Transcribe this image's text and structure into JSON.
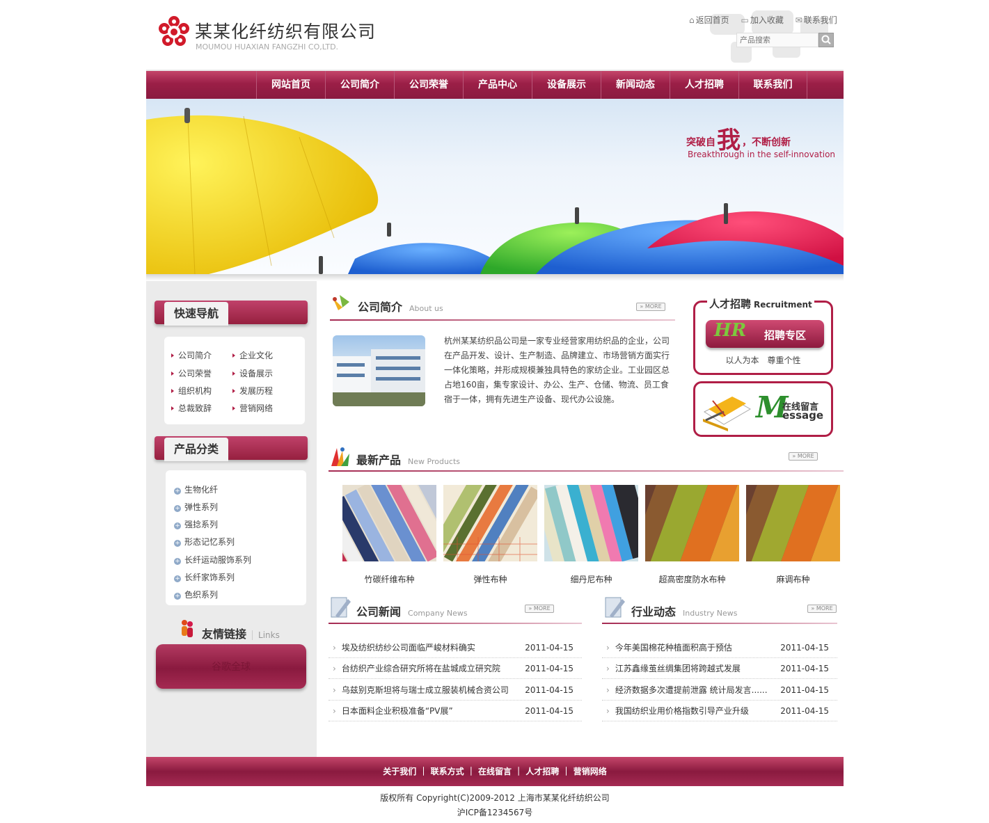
{
  "header": {
    "company_cn": "某某化纤纺织有限公司",
    "company_en": "MOUMOU HUAXIAN FANGZHI CO,LTD.",
    "top_links": [
      "返回首页",
      "加入收藏",
      "联系我们"
    ],
    "search_placeholder": "产品搜索"
  },
  "nav": [
    "网站首页",
    "公司简介",
    "公司荣誉",
    "产品中心",
    "设备展示",
    "新闻动态",
    "人才招聘",
    "联系我们"
  ],
  "banner": {
    "slogan_a": "突破自",
    "slogan_big": "我",
    "slogan_b": "，不断创新",
    "slogan_en": "Breakthrough in the self-innovation"
  },
  "quick_nav": {
    "title": "快速导航",
    "items": [
      "公司简介",
      "企业文化",
      "公司荣誉",
      "设备展示",
      "组织机构",
      "发展历程",
      "总裁致辞",
      "营销网络"
    ]
  },
  "categories": {
    "title": "产品分类",
    "items": [
      "生物化纤",
      "弹性系列",
      "强捻系列",
      "形态记忆系列",
      "长纤运动服饰系列",
      "长纤家饰系列",
      "色织系列"
    ]
  },
  "links": {
    "title": "友情链接",
    "title_en": "Links",
    "items": [
      "谷歌全球"
    ]
  },
  "about": {
    "title": "公司简介",
    "title_en": "About us",
    "more": "MORE",
    "text": "杭州某某纺织品公司是一家专业经营家用纺织品的企业，公司在产品开发、设计、生产制造、品牌建立、市场营销方面实行一体化策略，并形成规模兼独具特色的家纺企业。工业园区总占地160亩，集专家设计、办公、生产、仓储、物流、员工食宿于一体，拥有先进生产设备、现代办公设施。"
  },
  "products": {
    "title": "最新产品",
    "title_en": "New Products",
    "more": "MORE",
    "items": [
      "竹碳纤维布种",
      "弹性布种",
      "细丹尼布种",
      "超高密度防水布种",
      "麻调布种"
    ]
  },
  "company_news": {
    "title": "公司新闻",
    "title_en": "Company News",
    "more": "MORE",
    "items": [
      {
        "title": "埃及纺织纺纱公司面临严峻材料确实",
        "date": "2011-04-15"
      },
      {
        "title": "台纺织产业综合研究所将在盐城成立研究院",
        "date": "2011-04-15"
      },
      {
        "title": "乌兹别克斯坦将与瑞士成立服装机械合资公司",
        "date": "2011-04-15"
      },
      {
        "title": "日本面料企业积极准备“PV展”",
        "date": "2011-04-15"
      }
    ]
  },
  "industry_news": {
    "title": "行业动态",
    "title_en": "Industry News",
    "more": "MORE",
    "items": [
      {
        "title": "今年美国棉花种植面积高于预估",
        "date": "2011-04-15"
      },
      {
        "title": "江苏鑫缘茧丝绸集团将跨越式发展",
        "date": "2011-04-15"
      },
      {
        "title": "经济数据多次遭提前泄露 统计局发言......",
        "date": "2011-04-15"
      },
      {
        "title": "我国纺织业用价格指数引导产业升级",
        "date": "2011-04-15"
      }
    ]
  },
  "recruit": {
    "title": "人才招聘",
    "title_en": "Recruitment",
    "button_logo": "HR",
    "button_label": "招聘专区",
    "slogan": "以人为本　尊重个性"
  },
  "message": {
    "letter": "M",
    "cn": "在线留言",
    "en": "essage"
  },
  "footer": {
    "links": "关于我们 ｜ 联系方式 ｜ 在线留言 ｜ 人才招聘 ｜ 营销网络",
    "copyright": "版权所有 Copyright(C)2009-2012 上海市某某化纤纺织公司",
    "icp": "沪ICP备1234567号"
  },
  "colors": {
    "brand": "#9b1f47",
    "accent_light": "#c4456a"
  }
}
